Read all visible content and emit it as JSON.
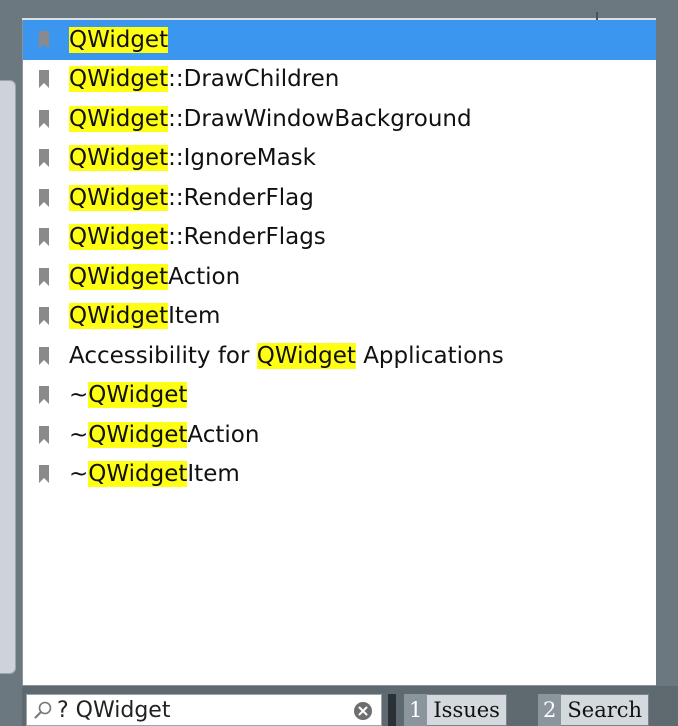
{
  "completer": {
    "items": [
      {
        "prefix": "",
        "match": "QWidget",
        "suffix": "",
        "selected": true
      },
      {
        "prefix": "",
        "match": "QWidget",
        "suffix": "::DrawChildren",
        "selected": false
      },
      {
        "prefix": "",
        "match": "QWidget",
        "suffix": "::DrawWindowBackground",
        "selected": false
      },
      {
        "prefix": "",
        "match": "QWidget",
        "suffix": "::IgnoreMask",
        "selected": false
      },
      {
        "prefix": "",
        "match": "QWidget",
        "suffix": "::RenderFlag",
        "selected": false
      },
      {
        "prefix": "",
        "match": "QWidget",
        "suffix": "::RenderFlags",
        "selected": false
      },
      {
        "prefix": "",
        "match": "QWidget",
        "suffix": "Action",
        "selected": false
      },
      {
        "prefix": "",
        "match": "QWidget",
        "suffix": "Item",
        "selected": false
      },
      {
        "prefix": "Accessibility for ",
        "match": "QWidget",
        "suffix": " Applications",
        "selected": false
      },
      {
        "prefix": "~",
        "match": "QWidget",
        "suffix": "",
        "selected": false
      },
      {
        "prefix": "~",
        "match": "QWidget",
        "suffix": "Action",
        "selected": false
      },
      {
        "prefix": "~",
        "match": "QWidget",
        "suffix": "Item",
        "selected": false
      }
    ]
  },
  "locator": {
    "value": "? QWidget",
    "icon": "search-icon"
  },
  "output_tabs": [
    {
      "number": "1",
      "label": "Issues"
    },
    {
      "number": "2",
      "label": "Search"
    }
  ],
  "colors": {
    "selection": "#3a96ee",
    "highlight": "#ffff14"
  }
}
